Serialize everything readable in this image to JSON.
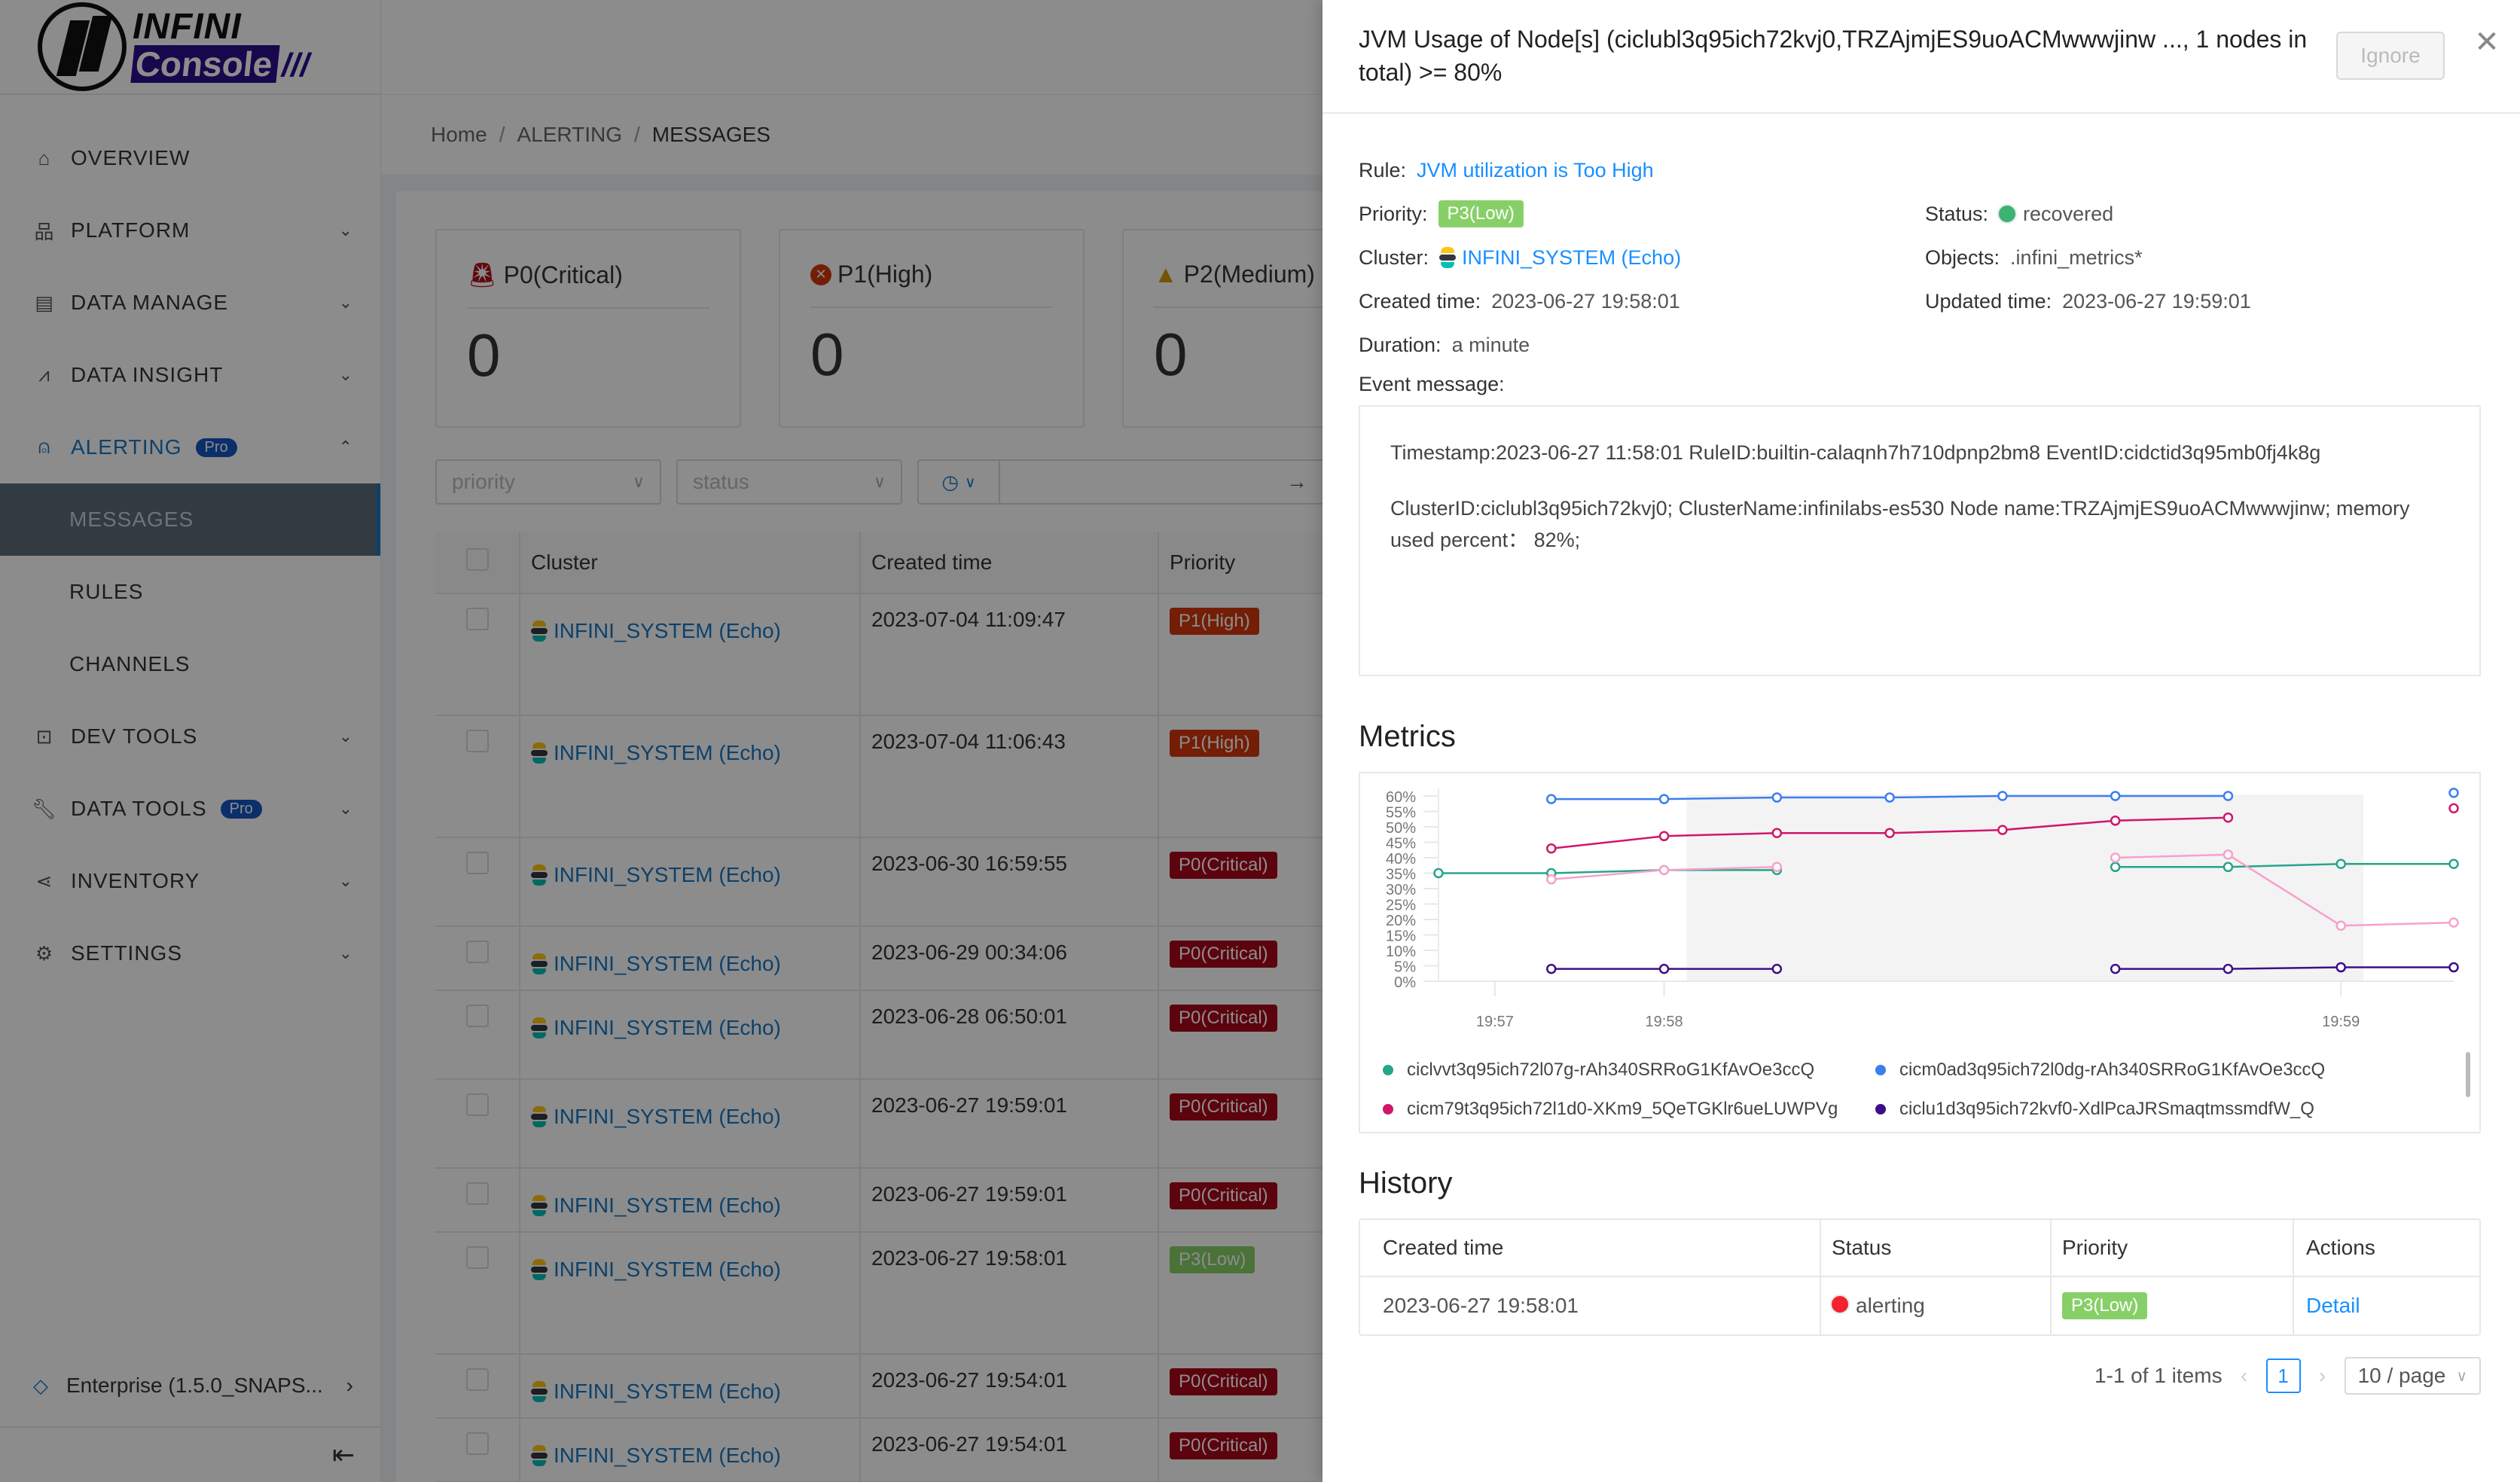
{
  "app": {
    "logo": {
      "top": "INFINI",
      "bottom": "Console"
    },
    "sidebar": {
      "items": [
        {
          "label": "OVERVIEW",
          "icon": "home-icon",
          "has_children": false
        },
        {
          "label": "PLATFORM",
          "icon": "sitemap-icon",
          "has_children": true
        },
        {
          "label": "DATA MANAGE",
          "icon": "database-icon",
          "has_children": true
        },
        {
          "label": "DATA INSIGHT",
          "icon": "area-chart-icon",
          "has_children": true
        },
        {
          "label": "ALERTING",
          "icon": "siren-icon",
          "badge": "Pro",
          "has_children": true,
          "expanded": true,
          "children": [
            {
              "label": "MESSAGES",
              "selected": true
            },
            {
              "label": "RULES"
            },
            {
              "label": "CHANNELS"
            }
          ]
        },
        {
          "label": "DEV TOOLS",
          "icon": "terminal-icon",
          "has_children": true
        },
        {
          "label": "DATA TOOLS",
          "icon": "wrench-icon",
          "badge": "Pro",
          "has_children": true
        },
        {
          "label": "INVENTORY",
          "icon": "share-icon",
          "has_children": true
        },
        {
          "label": "SETTINGS",
          "icon": "gear-icon",
          "has_children": true
        }
      ],
      "footer": {
        "edition": "Enterprise (1.5.0_SNAPS...",
        "collapse_icon": "menu-fold-icon"
      }
    },
    "breadcrumb": [
      "Home",
      "ALERTING",
      "MESSAGES"
    ],
    "stats": [
      {
        "label": "P0(Critical)",
        "value": "0",
        "icon": "siren-icon"
      },
      {
        "label": "P1(High)",
        "value": "0",
        "icon": "close-circle-icon"
      },
      {
        "label": "P2(Medium)",
        "value": "0",
        "icon": "warning-icon"
      }
    ],
    "filters": {
      "priority_placeholder": "priority",
      "status_placeholder": "status"
    },
    "messages_table": {
      "columns": [
        "Cluster",
        "Created time",
        "Priority"
      ],
      "rows": [
        {
          "cluster": "INFINI_SYSTEM (Echo)",
          "created": "2023-07-04 11:09:47",
          "priority": "P1(High)",
          "level": "p1"
        },
        {
          "cluster": "INFINI_SYSTEM (Echo)",
          "created": "2023-07-04 11:06:43",
          "priority": "P1(High)",
          "level": "p1"
        },
        {
          "cluster": "INFINI_SYSTEM (Echo)",
          "created": "2023-06-30 16:59:55",
          "priority": "P0(Critical)",
          "level": "p0"
        },
        {
          "cluster": "INFINI_SYSTEM (Echo)",
          "created": "2023-06-29 00:34:06",
          "priority": "P0(Critical)",
          "level": "p0"
        },
        {
          "cluster": "INFINI_SYSTEM (Echo)",
          "created": "2023-06-28 06:50:01",
          "priority": "P0(Critical)",
          "level": "p0"
        },
        {
          "cluster": "INFINI_SYSTEM (Echo)",
          "created": "2023-06-27 19:59:01",
          "priority": "P0(Critical)",
          "level": "p0"
        },
        {
          "cluster": "INFINI_SYSTEM (Echo)",
          "created": "2023-06-27 19:59:01",
          "priority": "P0(Critical)",
          "level": "p0"
        },
        {
          "cluster": "INFINI_SYSTEM (Echo)",
          "created": "2023-06-27 19:58:01",
          "priority": "P3(Low)",
          "level": "p3"
        },
        {
          "cluster": "INFINI_SYSTEM (Echo)",
          "created": "2023-06-27 19:54:01",
          "priority": "P0(Critical)",
          "level": "p0"
        },
        {
          "cluster": "INFINI_SYSTEM (Echo)",
          "created": "2023-06-27 19:54:01",
          "priority": "P0(Critical)",
          "level": "p0"
        }
      ]
    }
  },
  "drawer": {
    "title": "JVM Usage of Node[s] (ciclubl3q95ich72kvj0,TRZAjmjES9uoACMwwwjinw ..., 1 nodes in total) >= 80%",
    "ignore_label": "Ignore",
    "close_icon": "close-icon",
    "rule": {
      "label": "Rule:",
      "value": "JVM utilization is Too High"
    },
    "priority": {
      "label": "Priority:",
      "value": "P3(Low)",
      "color": "#87d068"
    },
    "status": {
      "label": "Status:",
      "value": "recovered",
      "color": "#3cb371"
    },
    "cluster": {
      "label": "Cluster:",
      "value": "INFINI_SYSTEM (Echo)"
    },
    "objects": {
      "label": "Objects:",
      "value": ".infini_metrics*"
    },
    "created": {
      "label": "Created time:",
      "value": "2023-06-27 19:58:01"
    },
    "updated": {
      "label": "Updated time:",
      "value": "2023-06-27 19:59:01"
    },
    "duration": {
      "label": "Duration:",
      "value": "a minute"
    },
    "event_message_label": "Event message:",
    "event_message": [
      "Timestamp:2023-06-27 11:58:01 RuleID:builtin-calaqnh7h710dpnp2bm8 EventID:cidctid3q95mb0fj4k8g",
      "ClusterID:ciclubl3q95ich72kvj0; ClusterName:infinilabs-es530 Node name:TRZAjmjES9uoACMwwwjinw; memory used percent： 82%;"
    ],
    "metrics_title": "Metrics",
    "history_title": "History",
    "history": {
      "columns": [
        "Created time",
        "Status",
        "Priority",
        "Actions"
      ],
      "rows": [
        {
          "created": "2023-06-27 19:58:01",
          "status": "alerting",
          "status_color": "#f5222d",
          "priority": "P3(Low)",
          "action": "Detail"
        }
      ]
    },
    "pagination": {
      "summary": "1-1 of 1 items",
      "current_page": "1",
      "page_size": "10 / page"
    }
  },
  "chart_data": {
    "type": "line",
    "title": "",
    "xlabel": "",
    "ylabel": "",
    "x_tick_labels": [
      {
        "label": "19:57",
        "index": 0.5
      },
      {
        "label": "19:58",
        "index": 2
      },
      {
        "label": "19:59",
        "index": 8
      }
    ],
    "point_count": 10,
    "yticks": [
      "0%",
      "5%",
      "10%",
      "15%",
      "20%",
      "25%",
      "30%",
      "35%",
      "40%",
      "45%",
      "50%",
      "55%",
      "60%"
    ],
    "ylim": [
      0,
      60
    ],
    "highlight_band": {
      "from_index": 2.2,
      "to_index": 8.2
    },
    "grid": true,
    "legend_position": "bottom",
    "series": [
      {
        "name": "ciclvvt3q95ich72l07g-rAh340SRRoG1KfAvOe3ccQ",
        "color": "#26a58a",
        "values": [
          35,
          35,
          36,
          36,
          null,
          null,
          37,
          37,
          38,
          38
        ]
      },
      {
        "name": "cicm0ad3q95ich72l0dg-rAh340SRRoG1KfAvOe3ccQ",
        "color": "#3b7ef0",
        "values": [
          null,
          59,
          59,
          59.5,
          59.5,
          60,
          60,
          60,
          null,
          61
        ]
      },
      {
        "name": "cicm79t3q95ich72l1d0-XKm9_5QeTGKlr6ueLUWPVg",
        "color": "#d1166b",
        "values": [
          null,
          43,
          47,
          48,
          48,
          49,
          52,
          53,
          null,
          56
        ]
      },
      {
        "name": "ciclu1d3q95ich72kvf0-XdlPcaJRSmaqtmssmdfW_Q",
        "color": "#3e0e8a",
        "values": [
          null,
          4,
          4,
          4,
          null,
          null,
          4,
          4,
          4.5,
          4.5
        ]
      },
      {
        "name": "pink-series",
        "color": "#f7a1cc",
        "legend": false,
        "values": [
          null,
          33,
          36,
          37,
          null,
          null,
          40,
          41,
          18,
          19
        ]
      }
    ]
  }
}
